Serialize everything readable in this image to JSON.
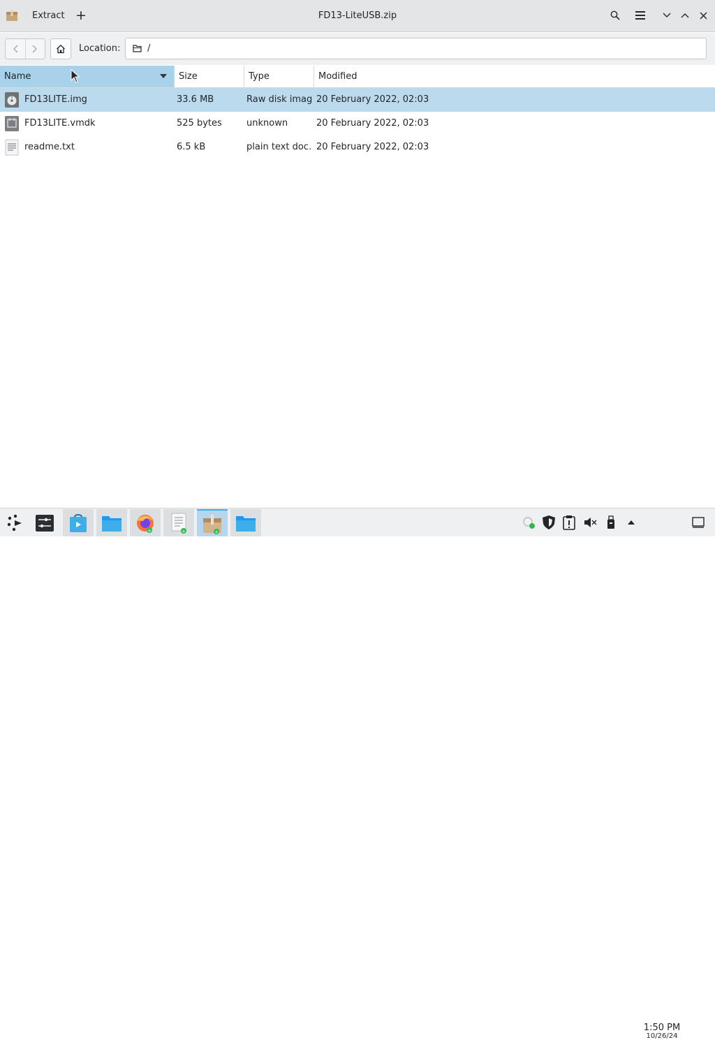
{
  "window": {
    "title": "FD13-LiteUSB.zip",
    "extract_label": "Extract",
    "add_label": "+"
  },
  "location": {
    "label": "Location:",
    "path": "/"
  },
  "columns": [
    "Name",
    "Size",
    "Type",
    "Modified"
  ],
  "sorted_column": "Name",
  "files": [
    {
      "name": "FD13LITE.img",
      "size": "33.6 MB",
      "type": "Raw disk image",
      "modified": "20 February 2022, 02:03",
      "icon": "disk-image-icon",
      "selected": true
    },
    {
      "name": "FD13LITE.vmdk",
      "size": "525 bytes",
      "type": "unknown",
      "modified": "20 February 2022, 02:03",
      "icon": "unknown-file-icon",
      "selected": false
    },
    {
      "name": "readme.txt",
      "size": "6.5 kB",
      "type": "plain text doc…",
      "modified": "20 February 2022, 02:03",
      "icon": "text-file-icon",
      "selected": false
    }
  ],
  "taskbar": {
    "apps": [
      {
        "name": "app-launcher",
        "icon": "launcher-icon"
      },
      {
        "name": "system-settings",
        "icon": "settings-panel-icon"
      },
      {
        "name": "discover",
        "icon": "store-icon"
      },
      {
        "name": "file-manager",
        "icon": "folder-icon"
      },
      {
        "name": "firefox",
        "icon": "firefox-icon"
      },
      {
        "name": "text-editor",
        "icon": "document-icon"
      },
      {
        "name": "ark",
        "icon": "archive-icon"
      },
      {
        "name": "file-manager-2",
        "icon": "folder-icon"
      }
    ],
    "clock_time": "1:50 PM",
    "clock_date": "10/26/24"
  },
  "colors": {
    "selection": "#bcdaee",
    "header_sorted": "#a8d1ea",
    "accent": "#3daee9"
  }
}
